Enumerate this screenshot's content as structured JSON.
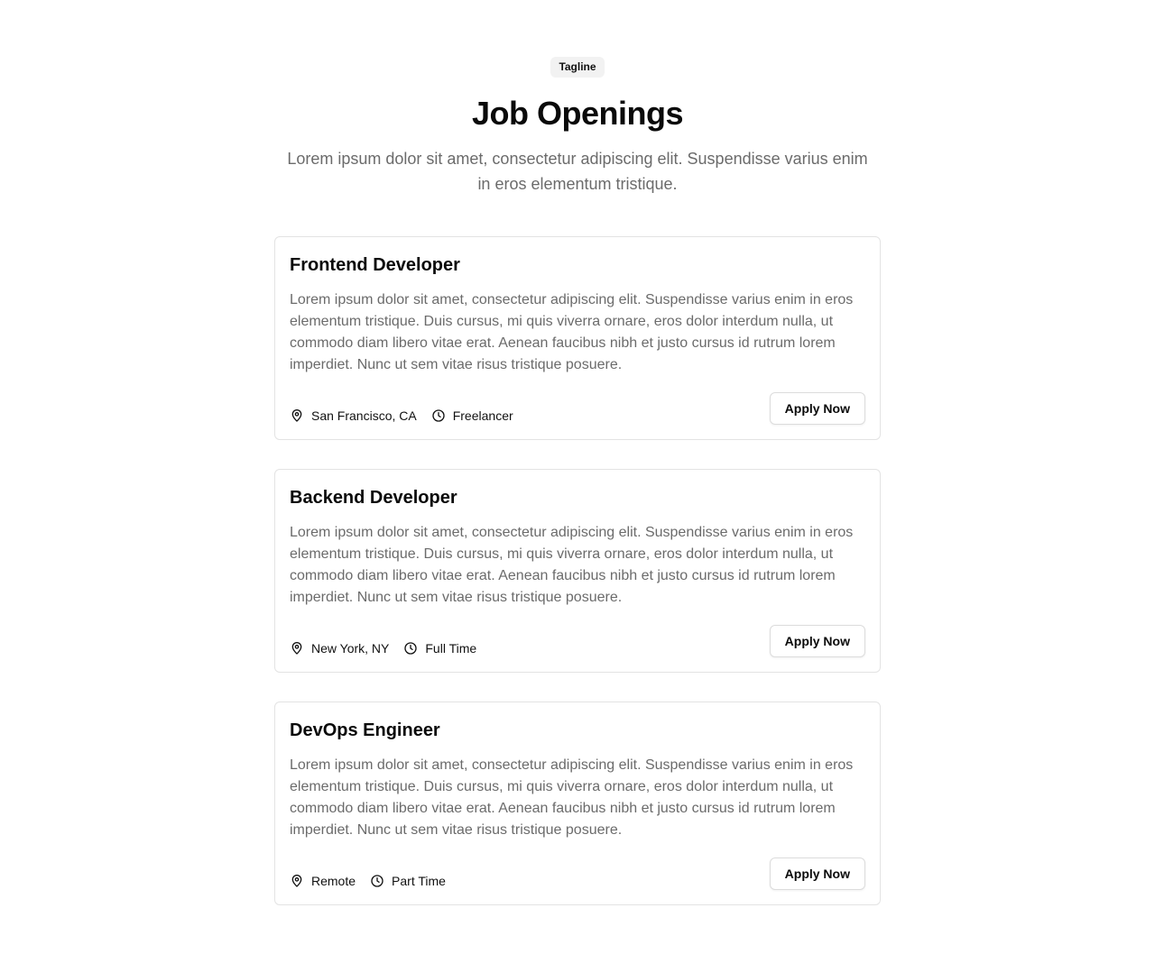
{
  "header": {
    "tagline": "Tagline",
    "title": "Job Openings",
    "subtitle": "Lorem ipsum dolor sit amet, consectetur adipiscing elit. Suspendisse varius enim in eros elementum tristique."
  },
  "jobs": [
    {
      "title": "Frontend Developer",
      "description": "Lorem ipsum dolor sit amet, consectetur adipiscing elit. Suspendisse varius enim in eros elementum tristique. Duis cursus, mi quis viverra ornare, eros dolor interdum nulla, ut commodo diam libero vitae erat. Aenean faucibus nibh et justo cursus id rutrum lorem imperdiet. Nunc ut sem vitae risus tristique posuere.",
      "location": "San Francisco, CA",
      "type": "Freelancer",
      "button_label": "Apply Now"
    },
    {
      "title": "Backend Developer",
      "description": "Lorem ipsum dolor sit amet, consectetur adipiscing elit. Suspendisse varius enim in eros elementum tristique. Duis cursus, mi quis viverra ornare, eros dolor interdum nulla, ut commodo diam libero vitae erat. Aenean faucibus nibh et justo cursus id rutrum lorem imperdiet. Nunc ut sem vitae risus tristique posuere.",
      "location": "New York, NY",
      "type": "Full Time",
      "button_label": "Apply Now"
    },
    {
      "title": "DevOps Engineer",
      "description": "Lorem ipsum dolor sit amet, consectetur adipiscing elit. Suspendisse varius enim in eros elementum tristique. Duis cursus, mi quis viverra ornare, eros dolor interdum nulla, ut commodo diam libero vitae erat. Aenean faucibus nibh et justo cursus id rutrum lorem imperdiet. Nunc ut sem vitae risus tristique posuere.",
      "location": "Remote",
      "type": "Part Time",
      "button_label": "Apply Now"
    }
  ],
  "icons": {
    "location": "map-pin-icon",
    "type": "clock-icon"
  },
  "colors": {
    "text": "#0a0a0a",
    "muted": "#6b6b6b",
    "border": "#e3e3e3",
    "tagline_bg": "#f2f2f2"
  }
}
